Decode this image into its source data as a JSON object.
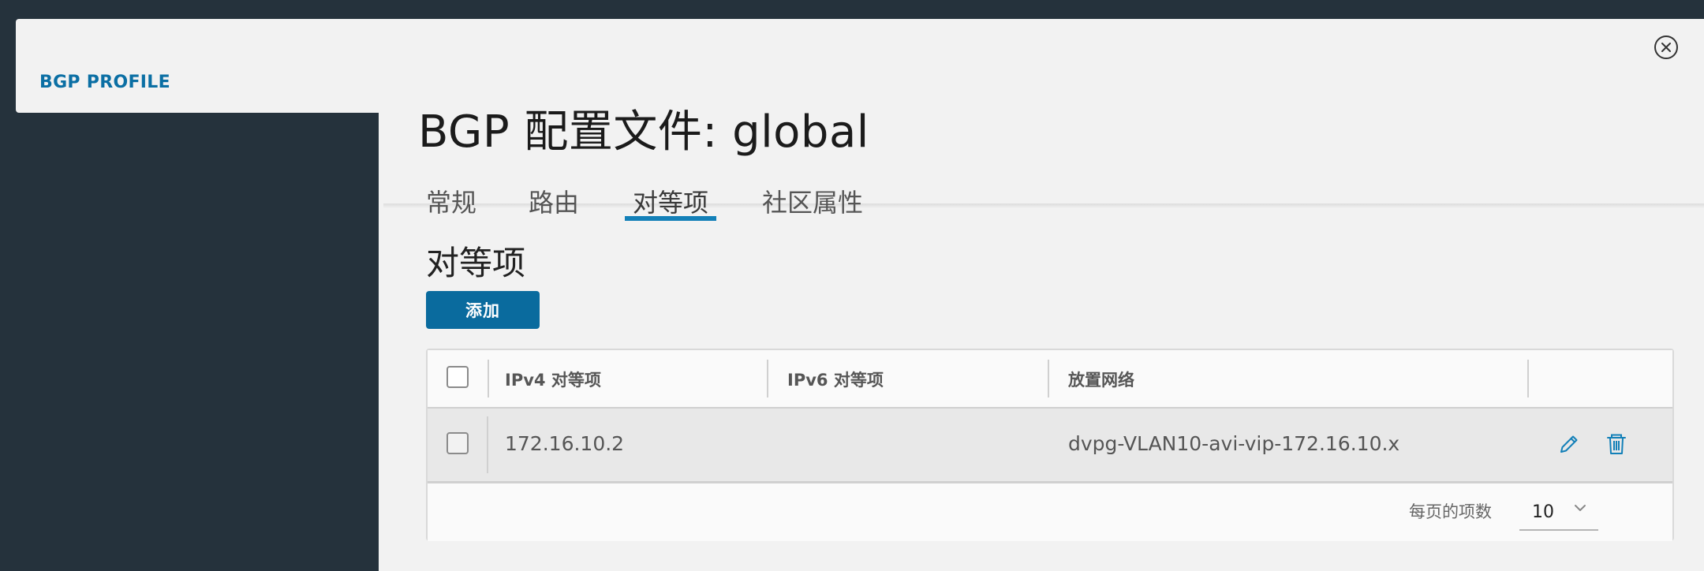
{
  "sidebar": {
    "label": "BGP PROFILE"
  },
  "modal": {
    "title": "BGP 配置文件: global"
  },
  "tabs": [
    {
      "label": "常规"
    },
    {
      "label": "路由"
    },
    {
      "label": "对等项"
    },
    {
      "label": "社区属性"
    }
  ],
  "active_tab": "对等项",
  "section": {
    "title": "对等项",
    "add_label": "添加"
  },
  "table": {
    "headers": [
      "IPv4 对等项",
      "IPv6 对等项",
      "放置网络"
    ],
    "rows": [
      {
        "ipv4": "172.16.10.2",
        "ipv6": "",
        "network": "dvpg-VLAN10-avi-vip-172.16.10.x"
      }
    ],
    "footer": {
      "per_page_label": "每页的项数",
      "per_page_value": "10"
    }
  },
  "colors": {
    "accent": "#0a6b9e",
    "tab_underline": "#1380b8",
    "background": "#25323c",
    "panel": "#f2f2f2"
  },
  "icons": [
    "close-icon",
    "edit-icon",
    "trash-icon",
    "chevron-down-icon"
  ]
}
